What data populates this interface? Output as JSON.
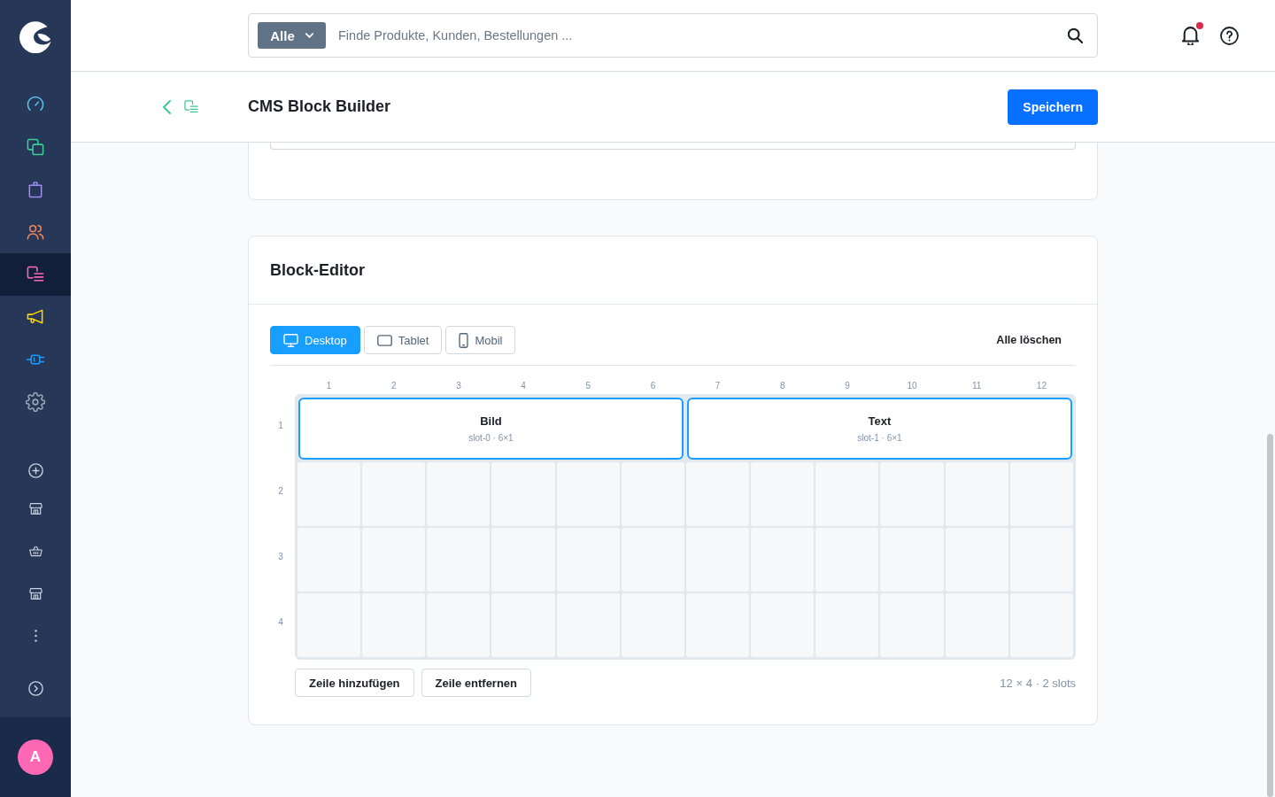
{
  "sidebar": {
    "items": [
      {
        "kind": "dashboard",
        "color": "#57c3e8",
        "selected": false
      },
      {
        "kind": "catalogues",
        "color": "#3ccf9a",
        "selected": false
      },
      {
        "kind": "orders",
        "color": "#9d8cf2",
        "selected": false
      },
      {
        "kind": "customers",
        "color": "#f4895f",
        "selected": false
      },
      {
        "kind": "content",
        "color": "#ff68b4",
        "selected": true
      },
      {
        "kind": "marketing",
        "color": "#ffd700",
        "selected": false
      },
      {
        "kind": "extensions",
        "color": "#189eff",
        "selected": false
      },
      {
        "kind": "settings",
        "color": "#9aa8b8",
        "selected": false
      }
    ],
    "user": {
      "initial": "A"
    }
  },
  "topbar": {
    "search": {
      "scope": "Alle",
      "placeholder": "Finde Produkte, Kunden, Bestellungen ..."
    },
    "notifications": {
      "unread": true
    }
  },
  "header": {
    "title": "CMS Block Builder",
    "save_button": "Speichern"
  },
  "block_editor": {
    "title": "Block-Editor",
    "viewports": [
      {
        "label": "Desktop",
        "kind": "desktop",
        "selected": true
      },
      {
        "label": "Tablet",
        "kind": "tablet",
        "selected": false
      },
      {
        "label": "Mobil",
        "kind": "mobile",
        "selected": false
      }
    ],
    "clear_all": "Alle löschen",
    "columns": [
      "1",
      "2",
      "3",
      "4",
      "5",
      "6",
      "7",
      "8",
      "9",
      "10",
      "11",
      "12"
    ],
    "rows": [
      {
        "label": "1",
        "slots": [
          {
            "title": "Bild",
            "caption": "slot-0 · 6×1"
          },
          {
            "title": "Text",
            "caption": "slot-1 · 6×1"
          }
        ]
      },
      {
        "label": "2"
      },
      {
        "label": "3"
      },
      {
        "label": "4"
      }
    ],
    "actions": [
      "Zeile hinzufügen",
      "Zeile entfernen"
    ],
    "summary": "12 × 4 · 2 slots"
  }
}
